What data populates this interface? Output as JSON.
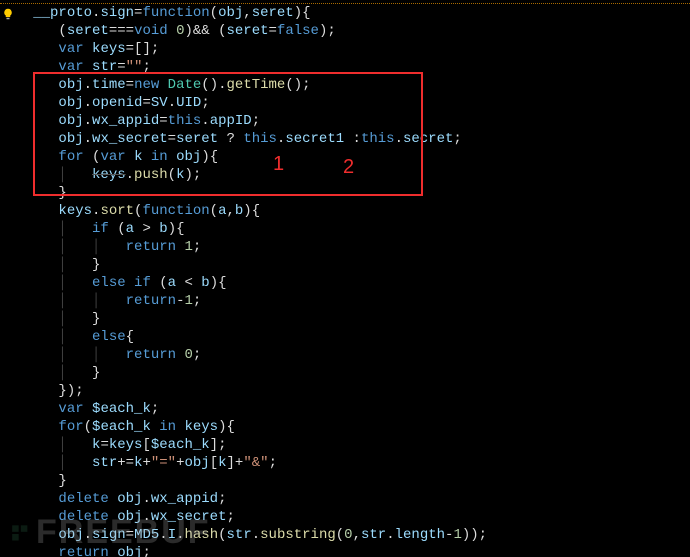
{
  "code": {
    "l1a": "__proto",
    "l1b": ".",
    "l1c": "sign",
    "l1d": "=",
    "l1e": "function",
    "l1f": "(",
    "l1g": "obj",
    "l1h": ",",
    "l1i": "seret",
    "l1j": "){",
    "l2a": "(",
    "l2b": "seret",
    "l2c": "===",
    "l2d": "void",
    "l2e": " 0",
    "l2f": ")&& (",
    "l2g": "seret",
    "l2h": "=",
    "l2i": "false",
    "l2j": ");",
    "l3a": "var",
    "l3b": " keys",
    "l3c": "=[];",
    "l4a": "var",
    "l4b": " str",
    "l4c": "=",
    "l4d": "\"\"",
    "l4e": ";",
    "l5a": "obj",
    "l5b": ".",
    "l5c": "time",
    "l5d": "=",
    "l5e": "new",
    "l5f": " Date",
    "l5g": "().",
    "l5h": "getTime",
    "l5i": "();",
    "l6a": "obj",
    "l6b": ".",
    "l6c": "openid",
    "l6d": "=",
    "l6e": "SV",
    "l6f": ".",
    "l6g": "UID",
    "l6h": ";",
    "l7a": "obj",
    "l7b": ".",
    "l7c": "wx_appid",
    "l7d": "=",
    "l7e": "this",
    "l7f": ".",
    "l7g": "appID",
    "l7h": ";",
    "l8a": "obj",
    "l8b": ".",
    "l8c": "wx_secret",
    "l8d": "=",
    "l8e": "seret",
    "l8f": " ? ",
    "l8g": "this",
    "l8h": ".",
    "l8i": "secret1",
    "l8j": " :",
    "l8k": "this",
    "l8l": ".",
    "l8m": "secret",
    "l8n": ";",
    "l9a": "for",
    "l9b": " (",
    "l9c": "var",
    "l9d": " k ",
    "l9e": "in",
    "l9f": " obj",
    "l9g": "){",
    "l10a": "keys",
    "l10b": ".",
    "l10c": "push",
    "l10d": "(",
    "l10e": "k",
    "l10f": ");",
    "l11a": "}",
    "l12a": "keys",
    "l12b": ".",
    "l12c": "sort",
    "l12d": "(",
    "l12e": "function",
    "l12f": "(",
    "l12g": "a",
    "l12h": ",",
    "l12i": "b",
    "l12j": "){",
    "l13a": "if",
    "l13b": " (",
    "l13c": "a",
    "l13d": " > ",
    "l13e": "b",
    "l13f": "){",
    "l14a": "return",
    "l14b": " 1",
    "l14c": ";",
    "l15a": "}",
    "l16a": "else if",
    "l16b": " (",
    "l16c": "a",
    "l16d": " < ",
    "l16e": "b",
    "l16f": "){",
    "l17a": "return",
    "l17b": "-",
    "l17c": "1",
    "l17d": ";",
    "l18a": "}",
    "l19a": "else",
    "l19b": "{",
    "l20a": "return",
    "l20b": " 0",
    "l20c": ";",
    "l21a": "}",
    "l22a": "});",
    "l23a": "var",
    "l23b": " $each_k",
    "l23c": ";",
    "l24a": "for",
    "l24b": "(",
    "l24c": "$each_k",
    "l24d": " in",
    "l24e": " keys",
    "l24f": "){",
    "l25a": "k",
    "l25b": "=",
    "l25c": "keys",
    "l25d": "[",
    "l25e": "$each_k",
    "l25f": "];",
    "l26a": "str",
    "l26b": "+=",
    "l26c": "k",
    "l26d": "+",
    "l26e": "\"=\"",
    "l26f": "+",
    "l26g": "obj",
    "l26h": "[",
    "l26i": "k",
    "l26j": "]+",
    "l26k": "\"&\"",
    "l26l": ";",
    "l27a": "}",
    "l28a": "delete",
    "l28b": " obj",
    "l28c": ".",
    "l28d": "wx_appid",
    "l28e": ";",
    "l29a": "delete",
    "l29b": " obj",
    "l29c": ".",
    "l29d": "wx_secret",
    "l29e": ";",
    "l30a": "obj",
    "l30b": ".",
    "l30c": "sign",
    "l30d": "=",
    "l30e": "MD5",
    "l30f": ".",
    "l30g": "I",
    "l30h": ".",
    "l30i": "hash",
    "l30j": "(",
    "l30k": "str",
    "l30l": ".",
    "l30m": "substring",
    "l30n": "(",
    "l30o": "0",
    "l30p": ",",
    "l30q": "str",
    "l30r": ".",
    "l30s": "length",
    "l30t": "-",
    "l30u": "1",
    "l30v": "));",
    "l31a": "return",
    "l31b": " obj",
    "l31c": ";"
  },
  "annotations": {
    "mark1": "1",
    "mark2": "2"
  },
  "watermark": {
    "text": "FREEBUF"
  }
}
